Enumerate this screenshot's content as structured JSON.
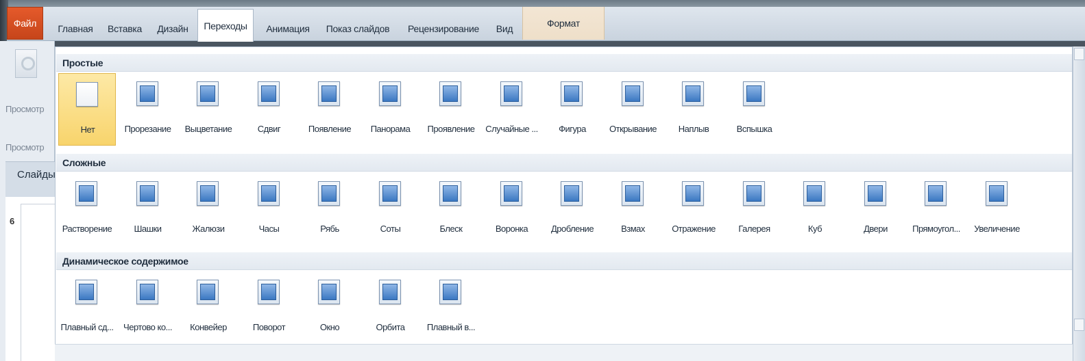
{
  "ribbon": {
    "tabs": [
      {
        "label": "Файл",
        "kind": "file"
      },
      {
        "label": "Главная",
        "kind": "normal"
      },
      {
        "label": "Вставка",
        "kind": "normal"
      },
      {
        "label": "Дизайн",
        "kind": "normal"
      },
      {
        "label": "Переходы",
        "kind": "active"
      },
      {
        "label": "Анимация",
        "kind": "normal"
      },
      {
        "label": "Показ слайдов",
        "kind": "normal"
      },
      {
        "label": "Рецензирование",
        "kind": "normal"
      },
      {
        "label": "Вид",
        "kind": "normal"
      },
      {
        "label": "Формат",
        "kind": "context"
      }
    ]
  },
  "left_pane": {
    "preview_button_label": "Просмотр",
    "preview_group_label": "Просмотр",
    "slides_tab_label": "Слайды",
    "slide_number": "6"
  },
  "gallery": {
    "sections": [
      {
        "title": "Простые",
        "items": [
          {
            "label": "Нет",
            "icon": "none-transition-icon",
            "selected": true
          },
          {
            "label": "Прорезание",
            "icon": "cut-transition-icon"
          },
          {
            "label": "Выцветание",
            "icon": "fade-transition-icon"
          },
          {
            "label": "Сдвиг",
            "icon": "push-transition-icon"
          },
          {
            "label": "Появление",
            "icon": "wipe-transition-icon"
          },
          {
            "label": "Панорама",
            "icon": "split-transition-icon"
          },
          {
            "label": "Проявление",
            "icon": "reveal-transition-icon"
          },
          {
            "label": "Случайные ...",
            "icon": "random-bars-transition-icon"
          },
          {
            "label": "Фигура",
            "icon": "shape-transition-icon"
          },
          {
            "label": "Открывание",
            "icon": "uncover-transition-icon"
          },
          {
            "label": "Наплыв",
            "icon": "cover-transition-icon"
          },
          {
            "label": "Вспышка",
            "icon": "flash-transition-icon"
          }
        ]
      },
      {
        "title": "Сложные",
        "items": [
          {
            "label": "Растворение",
            "icon": "dissolve-transition-icon"
          },
          {
            "label": "Шашки",
            "icon": "checkerboard-transition-icon"
          },
          {
            "label": "Жалюзи",
            "icon": "blinds-transition-icon"
          },
          {
            "label": "Часы",
            "icon": "clock-transition-icon"
          },
          {
            "label": "Рябь",
            "icon": "ripple-transition-icon"
          },
          {
            "label": "Соты",
            "icon": "honeycomb-transition-icon"
          },
          {
            "label": "Блеск",
            "icon": "glitter-transition-icon"
          },
          {
            "label": "Воронка",
            "icon": "vortex-transition-icon"
          },
          {
            "label": "Дробление",
            "icon": "shred-transition-icon"
          },
          {
            "label": "Взмах",
            "icon": "switch-transition-icon"
          },
          {
            "label": "Отражение",
            "icon": "flip-transition-icon"
          },
          {
            "label": "Галерея",
            "icon": "gallery-transition-icon"
          },
          {
            "label": "Куб",
            "icon": "cube-transition-icon"
          },
          {
            "label": "Двери",
            "icon": "doors-transition-icon"
          },
          {
            "label": "Прямоугол...",
            "icon": "box-transition-icon"
          },
          {
            "label": "Увеличение",
            "icon": "zoom-transition-icon"
          }
        ]
      },
      {
        "title": "Динамическое содержимое",
        "items": [
          {
            "label": "Плавный сд...",
            "icon": "pan-transition-icon"
          },
          {
            "label": "Чертово ко...",
            "icon": "ferris-wheel-transition-icon"
          },
          {
            "label": "Конвейер",
            "icon": "conveyor-transition-icon"
          },
          {
            "label": "Поворот",
            "icon": "rotate-transition-icon"
          },
          {
            "label": "Окно",
            "icon": "window-transition-icon"
          },
          {
            "label": "Орбита",
            "icon": "orbit-transition-icon"
          },
          {
            "label": "Плавный в...",
            "icon": "fly-through-transition-icon"
          }
        ]
      }
    ]
  }
}
